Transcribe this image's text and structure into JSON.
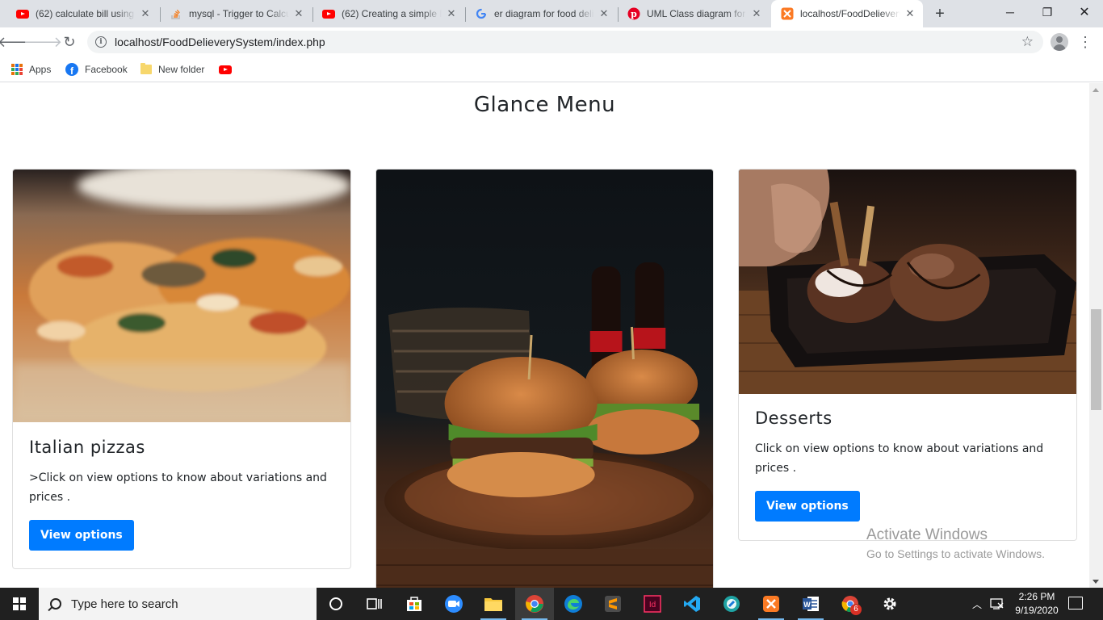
{
  "browser": {
    "tabs": [
      {
        "title": "(62) calculate bill using",
        "icon": "youtube-icon",
        "active": false
      },
      {
        "title": "mysql - Trigger to Calcu",
        "icon": "stackoverflow-icon",
        "active": false
      },
      {
        "title": "(62) Creating a simple M",
        "icon": "youtube-icon",
        "active": false
      },
      {
        "title": "er diagram for food deli",
        "icon": "google-icon",
        "active": false
      },
      {
        "title": "UML Class diagram for",
        "icon": "pinterest-icon",
        "active": false
      },
      {
        "title": "localhost/FoodDelievery",
        "icon": "xampp-icon",
        "active": true
      }
    ],
    "url": "localhost/FoodDelieverySystem/index.php",
    "bookmarks": [
      {
        "label": "Apps",
        "icon": "apps-grid-icon"
      },
      {
        "label": "Facebook",
        "icon": "facebook-icon"
      },
      {
        "label": "New folder",
        "icon": "folder-icon"
      },
      {
        "label": "",
        "icon": "youtube-icon"
      }
    ]
  },
  "page": {
    "section_title": "Glance Menu",
    "cards": [
      {
        "title": "Italian pizzas",
        "text": ">Click on view options to know about variations and prices .",
        "button": "View options",
        "image": "pizza-photo"
      },
      {
        "title": "",
        "text": "",
        "button": "",
        "image": "burger-photo"
      },
      {
        "title": "Desserts",
        "text": "Click on view options to know about variations and prices .",
        "button": "View options",
        "image": "dessert-photo"
      }
    ],
    "accent_color": "#007bff"
  },
  "watermark": {
    "line1": "Activate Windows",
    "line2": "Go to Settings to activate Windows."
  },
  "taskbar": {
    "search_placeholder": "Type here to search",
    "time": "2:26 PM",
    "date": "9/19/2020",
    "chrome_badge": "6"
  }
}
